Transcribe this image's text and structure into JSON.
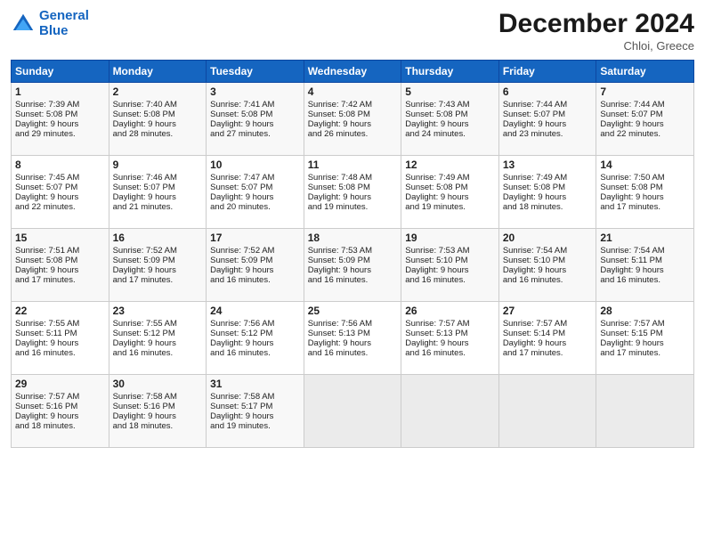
{
  "header": {
    "logo_line1": "General",
    "logo_line2": "Blue",
    "month_title": "December 2024",
    "location": "Chloi, Greece"
  },
  "days_of_week": [
    "Sunday",
    "Monday",
    "Tuesday",
    "Wednesday",
    "Thursday",
    "Friday",
    "Saturday"
  ],
  "weeks": [
    [
      {
        "day": 1,
        "lines": [
          "Sunrise: 7:39 AM",
          "Sunset: 5:08 PM",
          "Daylight: 9 hours",
          "and 29 minutes."
        ]
      },
      {
        "day": 2,
        "lines": [
          "Sunrise: 7:40 AM",
          "Sunset: 5:08 PM",
          "Daylight: 9 hours",
          "and 28 minutes."
        ]
      },
      {
        "day": 3,
        "lines": [
          "Sunrise: 7:41 AM",
          "Sunset: 5:08 PM",
          "Daylight: 9 hours",
          "and 27 minutes."
        ]
      },
      {
        "day": 4,
        "lines": [
          "Sunrise: 7:42 AM",
          "Sunset: 5:08 PM",
          "Daylight: 9 hours",
          "and 26 minutes."
        ]
      },
      {
        "day": 5,
        "lines": [
          "Sunrise: 7:43 AM",
          "Sunset: 5:08 PM",
          "Daylight: 9 hours",
          "and 24 minutes."
        ]
      },
      {
        "day": 6,
        "lines": [
          "Sunrise: 7:44 AM",
          "Sunset: 5:07 PM",
          "Daylight: 9 hours",
          "and 23 minutes."
        ]
      },
      {
        "day": 7,
        "lines": [
          "Sunrise: 7:44 AM",
          "Sunset: 5:07 PM",
          "Daylight: 9 hours",
          "and 22 minutes."
        ]
      }
    ],
    [
      {
        "day": 8,
        "lines": [
          "Sunrise: 7:45 AM",
          "Sunset: 5:07 PM",
          "Daylight: 9 hours",
          "and 22 minutes."
        ]
      },
      {
        "day": 9,
        "lines": [
          "Sunrise: 7:46 AM",
          "Sunset: 5:07 PM",
          "Daylight: 9 hours",
          "and 21 minutes."
        ]
      },
      {
        "day": 10,
        "lines": [
          "Sunrise: 7:47 AM",
          "Sunset: 5:07 PM",
          "Daylight: 9 hours",
          "and 20 minutes."
        ]
      },
      {
        "day": 11,
        "lines": [
          "Sunrise: 7:48 AM",
          "Sunset: 5:08 PM",
          "Daylight: 9 hours",
          "and 19 minutes."
        ]
      },
      {
        "day": 12,
        "lines": [
          "Sunrise: 7:49 AM",
          "Sunset: 5:08 PM",
          "Daylight: 9 hours",
          "and 19 minutes."
        ]
      },
      {
        "day": 13,
        "lines": [
          "Sunrise: 7:49 AM",
          "Sunset: 5:08 PM",
          "Daylight: 9 hours",
          "and 18 minutes."
        ]
      },
      {
        "day": 14,
        "lines": [
          "Sunrise: 7:50 AM",
          "Sunset: 5:08 PM",
          "Daylight: 9 hours",
          "and 17 minutes."
        ]
      }
    ],
    [
      {
        "day": 15,
        "lines": [
          "Sunrise: 7:51 AM",
          "Sunset: 5:08 PM",
          "Daylight: 9 hours",
          "and 17 minutes."
        ]
      },
      {
        "day": 16,
        "lines": [
          "Sunrise: 7:52 AM",
          "Sunset: 5:09 PM",
          "Daylight: 9 hours",
          "and 17 minutes."
        ]
      },
      {
        "day": 17,
        "lines": [
          "Sunrise: 7:52 AM",
          "Sunset: 5:09 PM",
          "Daylight: 9 hours",
          "and 16 minutes."
        ]
      },
      {
        "day": 18,
        "lines": [
          "Sunrise: 7:53 AM",
          "Sunset: 5:09 PM",
          "Daylight: 9 hours",
          "and 16 minutes."
        ]
      },
      {
        "day": 19,
        "lines": [
          "Sunrise: 7:53 AM",
          "Sunset: 5:10 PM",
          "Daylight: 9 hours",
          "and 16 minutes."
        ]
      },
      {
        "day": 20,
        "lines": [
          "Sunrise: 7:54 AM",
          "Sunset: 5:10 PM",
          "Daylight: 9 hours",
          "and 16 minutes."
        ]
      },
      {
        "day": 21,
        "lines": [
          "Sunrise: 7:54 AM",
          "Sunset: 5:11 PM",
          "Daylight: 9 hours",
          "and 16 minutes."
        ]
      }
    ],
    [
      {
        "day": 22,
        "lines": [
          "Sunrise: 7:55 AM",
          "Sunset: 5:11 PM",
          "Daylight: 9 hours",
          "and 16 minutes."
        ]
      },
      {
        "day": 23,
        "lines": [
          "Sunrise: 7:55 AM",
          "Sunset: 5:12 PM",
          "Daylight: 9 hours",
          "and 16 minutes."
        ]
      },
      {
        "day": 24,
        "lines": [
          "Sunrise: 7:56 AM",
          "Sunset: 5:12 PM",
          "Daylight: 9 hours",
          "and 16 minutes."
        ]
      },
      {
        "day": 25,
        "lines": [
          "Sunrise: 7:56 AM",
          "Sunset: 5:13 PM",
          "Daylight: 9 hours",
          "and 16 minutes."
        ]
      },
      {
        "day": 26,
        "lines": [
          "Sunrise: 7:57 AM",
          "Sunset: 5:13 PM",
          "Daylight: 9 hours",
          "and 16 minutes."
        ]
      },
      {
        "day": 27,
        "lines": [
          "Sunrise: 7:57 AM",
          "Sunset: 5:14 PM",
          "Daylight: 9 hours",
          "and 17 minutes."
        ]
      },
      {
        "day": 28,
        "lines": [
          "Sunrise: 7:57 AM",
          "Sunset: 5:15 PM",
          "Daylight: 9 hours",
          "and 17 minutes."
        ]
      }
    ],
    [
      {
        "day": 29,
        "lines": [
          "Sunrise: 7:57 AM",
          "Sunset: 5:16 PM",
          "Daylight: 9 hours",
          "and 18 minutes."
        ]
      },
      {
        "day": 30,
        "lines": [
          "Sunrise: 7:58 AM",
          "Sunset: 5:16 PM",
          "Daylight: 9 hours",
          "and 18 minutes."
        ]
      },
      {
        "day": 31,
        "lines": [
          "Sunrise: 7:58 AM",
          "Sunset: 5:17 PM",
          "Daylight: 9 hours",
          "and 19 minutes."
        ]
      },
      null,
      null,
      null,
      null
    ]
  ]
}
